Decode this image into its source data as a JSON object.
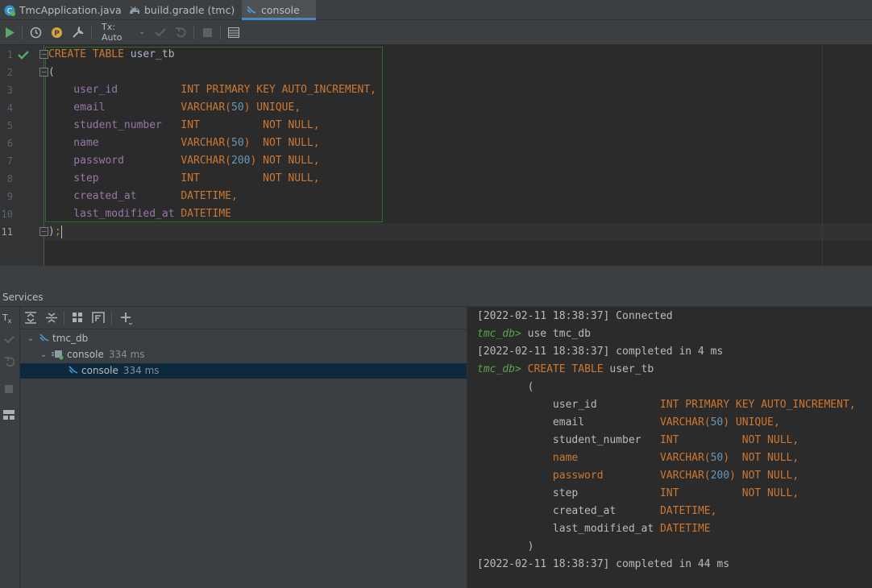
{
  "tabs": [
    {
      "label": "TmcApplication.java",
      "icon": "java-class-icon"
    },
    {
      "label": "build.gradle (tmc)",
      "icon": "gradle-icon"
    },
    {
      "label": "console",
      "icon": "database-console-icon",
      "active": true
    }
  ],
  "toolbar": {
    "tx_label": "Tx: Auto"
  },
  "editor": {
    "line_numbers": [
      "1",
      "2",
      "3",
      "4",
      "5",
      "6",
      "7",
      "8",
      "9",
      "10",
      "11"
    ],
    "lines": [
      [
        {
          "t": "CREATE TABLE ",
          "c": "kw"
        },
        {
          "t": "user_tb",
          "c": "plain"
        }
      ],
      [
        {
          "t": "(",
          "c": "plain"
        }
      ],
      [
        {
          "t": "    user_id          ",
          "c": "col"
        },
        {
          "t": "INT PRIMARY KEY AUTO_INCREMENT,",
          "c": "kw"
        }
      ],
      [
        {
          "t": "    email            ",
          "c": "col"
        },
        {
          "t": "VARCHAR(",
          "c": "kw"
        },
        {
          "t": "50",
          "c": "num"
        },
        {
          "t": ") UNIQUE,",
          "c": "kw"
        }
      ],
      [
        {
          "t": "    student_number   ",
          "c": "col"
        },
        {
          "t": "INT          NOT NULL,",
          "c": "kw"
        }
      ],
      [
        {
          "t": "    name             ",
          "c": "col"
        },
        {
          "t": "VARCHAR(",
          "c": "kw"
        },
        {
          "t": "50",
          "c": "num"
        },
        {
          "t": ")  NOT NULL,",
          "c": "kw"
        }
      ],
      [
        {
          "t": "    password         ",
          "c": "col"
        },
        {
          "t": "VARCHAR(",
          "c": "kw"
        },
        {
          "t": "200",
          "c": "num"
        },
        {
          "t": ") NOT NULL,",
          "c": "kw"
        }
      ],
      [
        {
          "t": "    step             ",
          "c": "col"
        },
        {
          "t": "INT          NOT NULL,",
          "c": "kw"
        }
      ],
      [
        {
          "t": "    created_at       ",
          "c": "col"
        },
        {
          "t": "DATETIME,",
          "c": "kw"
        }
      ],
      [
        {
          "t": "    last_modified_at ",
          "c": "col"
        },
        {
          "t": "DATETIME",
          "c": "kw"
        }
      ],
      [
        {
          "t": ")",
          "c": "plain"
        },
        {
          "t": ";",
          "c": "kw"
        }
      ]
    ]
  },
  "services": {
    "title": "Services",
    "tree": [
      {
        "label": "tmc_db",
        "time": ""
      },
      {
        "label": "console",
        "time": "334 ms"
      },
      {
        "label": "console",
        "time": "334 ms"
      }
    ]
  },
  "output": {
    "lines": [
      [
        {
          "t": "[2022-02-11 18:38:37] Connected",
          "c": ""
        }
      ],
      [
        {
          "t": "tmc_db> ",
          "c": "prompt"
        },
        {
          "t": "use tmc_db",
          "c": ""
        }
      ],
      [
        {
          "t": "[2022-02-11 18:38:37] completed in 4 ms",
          "c": ""
        }
      ],
      [
        {
          "t": "tmc_db> ",
          "c": "prompt"
        },
        {
          "t": "CREATE TABLE ",
          "c": "okw"
        },
        {
          "t": "user_tb",
          "c": ""
        }
      ],
      [
        {
          "t": "        (",
          "c": ""
        }
      ],
      [
        {
          "t": "            user_id          ",
          "c": ""
        },
        {
          "t": "INT PRIMARY KEY AUTO_INCREMENT,",
          "c": "okw"
        }
      ],
      [
        {
          "t": "            email            ",
          "c": ""
        },
        {
          "t": "VARCHAR(",
          "c": "okw"
        },
        {
          "t": "50",
          "c": "onum"
        },
        {
          "t": ") UNIQUE,",
          "c": "okw"
        }
      ],
      [
        {
          "t": "            student_number   ",
          "c": ""
        },
        {
          "t": "INT          NOT NULL,",
          "c": "okw"
        }
      ],
      [
        {
          "t": "            name             ",
          "c": "ocol"
        },
        {
          "t": "VARCHAR(",
          "c": "okw"
        },
        {
          "t": "50",
          "c": "onum"
        },
        {
          "t": ")  NOT NULL,",
          "c": "okw"
        }
      ],
      [
        {
          "t": "            password         ",
          "c": "ocol"
        },
        {
          "t": "VARCHAR(",
          "c": "okw"
        },
        {
          "t": "200",
          "c": "onum"
        },
        {
          "t": ") NOT NULL,",
          "c": "okw"
        }
      ],
      [
        {
          "t": "            step             ",
          "c": ""
        },
        {
          "t": "INT          NOT NULL,",
          "c": "okw"
        }
      ],
      [
        {
          "t": "            created_at       ",
          "c": ""
        },
        {
          "t": "DATETIME,",
          "c": "okw"
        }
      ],
      [
        {
          "t": "            last_modified_at ",
          "c": ""
        },
        {
          "t": "DATETIME",
          "c": "okw"
        }
      ],
      [
        {
          "t": "        )",
          "c": ""
        }
      ],
      [
        {
          "t": "[2022-02-11 18:38:37] completed in 44 ms",
          "c": ""
        }
      ]
    ]
  },
  "colors": {
    "keyword": "#cc7832",
    "column": "#9876aa",
    "number": "#6897bb",
    "prompt": "#57a64a",
    "accent": "#4a88c7"
  }
}
